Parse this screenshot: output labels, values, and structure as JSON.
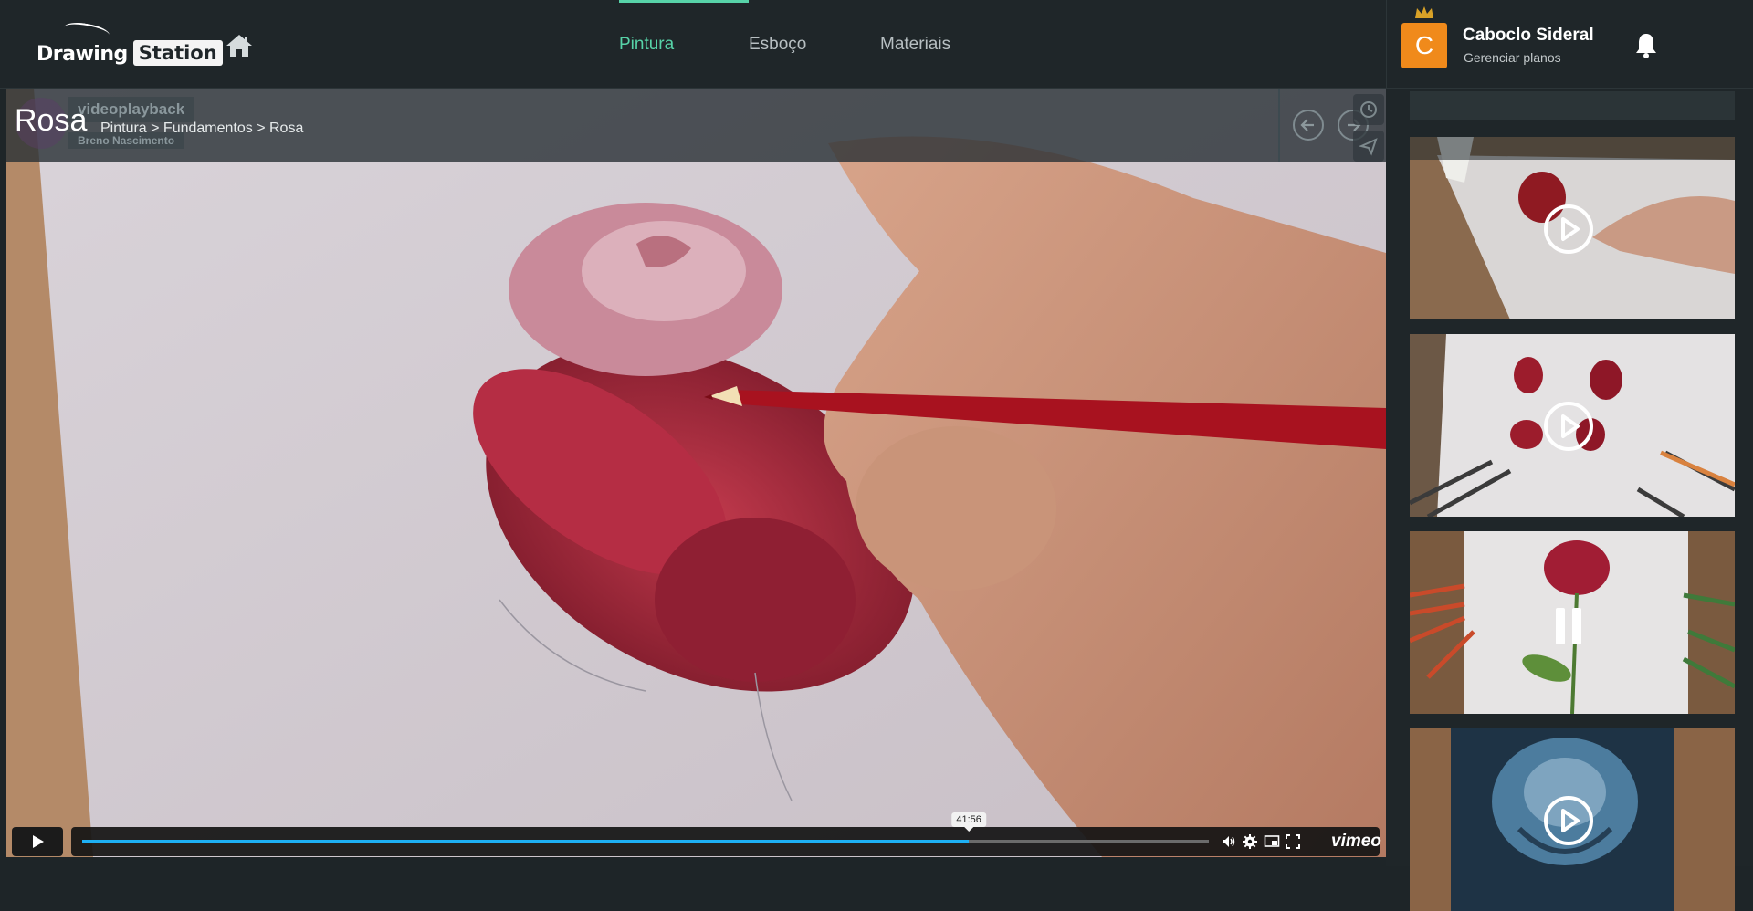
{
  "app": {
    "logo_word1": "Drawing",
    "logo_word2": "Station"
  },
  "nav": {
    "items": [
      {
        "label": "Pintura",
        "active": true
      },
      {
        "label": "Esboço",
        "active": false
      },
      {
        "label": "Materiais",
        "active": false
      }
    ]
  },
  "user": {
    "initial": "C",
    "name": "Caboclo Sideral",
    "plans_link": "Gerenciar planos"
  },
  "lesson": {
    "title": "Rosa",
    "breadcrumb": "Pintura > Fundamentos > Rosa"
  },
  "player": {
    "video_title": "videoplayback",
    "video_author": "Breno Nascimento",
    "hover_time": "41:56",
    "progress": 0.787,
    "brand": "vimeo",
    "accent": "#1eb0f4"
  },
  "playlist": [
    {
      "state": "play",
      "subject": "red rose sphere drawing"
    },
    {
      "state": "play",
      "subject": "rose petals with pencils"
    },
    {
      "state": "pause",
      "subject": "red rose with stem and pencils"
    },
    {
      "state": "play",
      "subject": "blue rose drawing"
    }
  ],
  "colors": {
    "accent_green": "#57d3a8",
    "avatar_orange": "#f08a1b",
    "crown": "#d9a227"
  }
}
